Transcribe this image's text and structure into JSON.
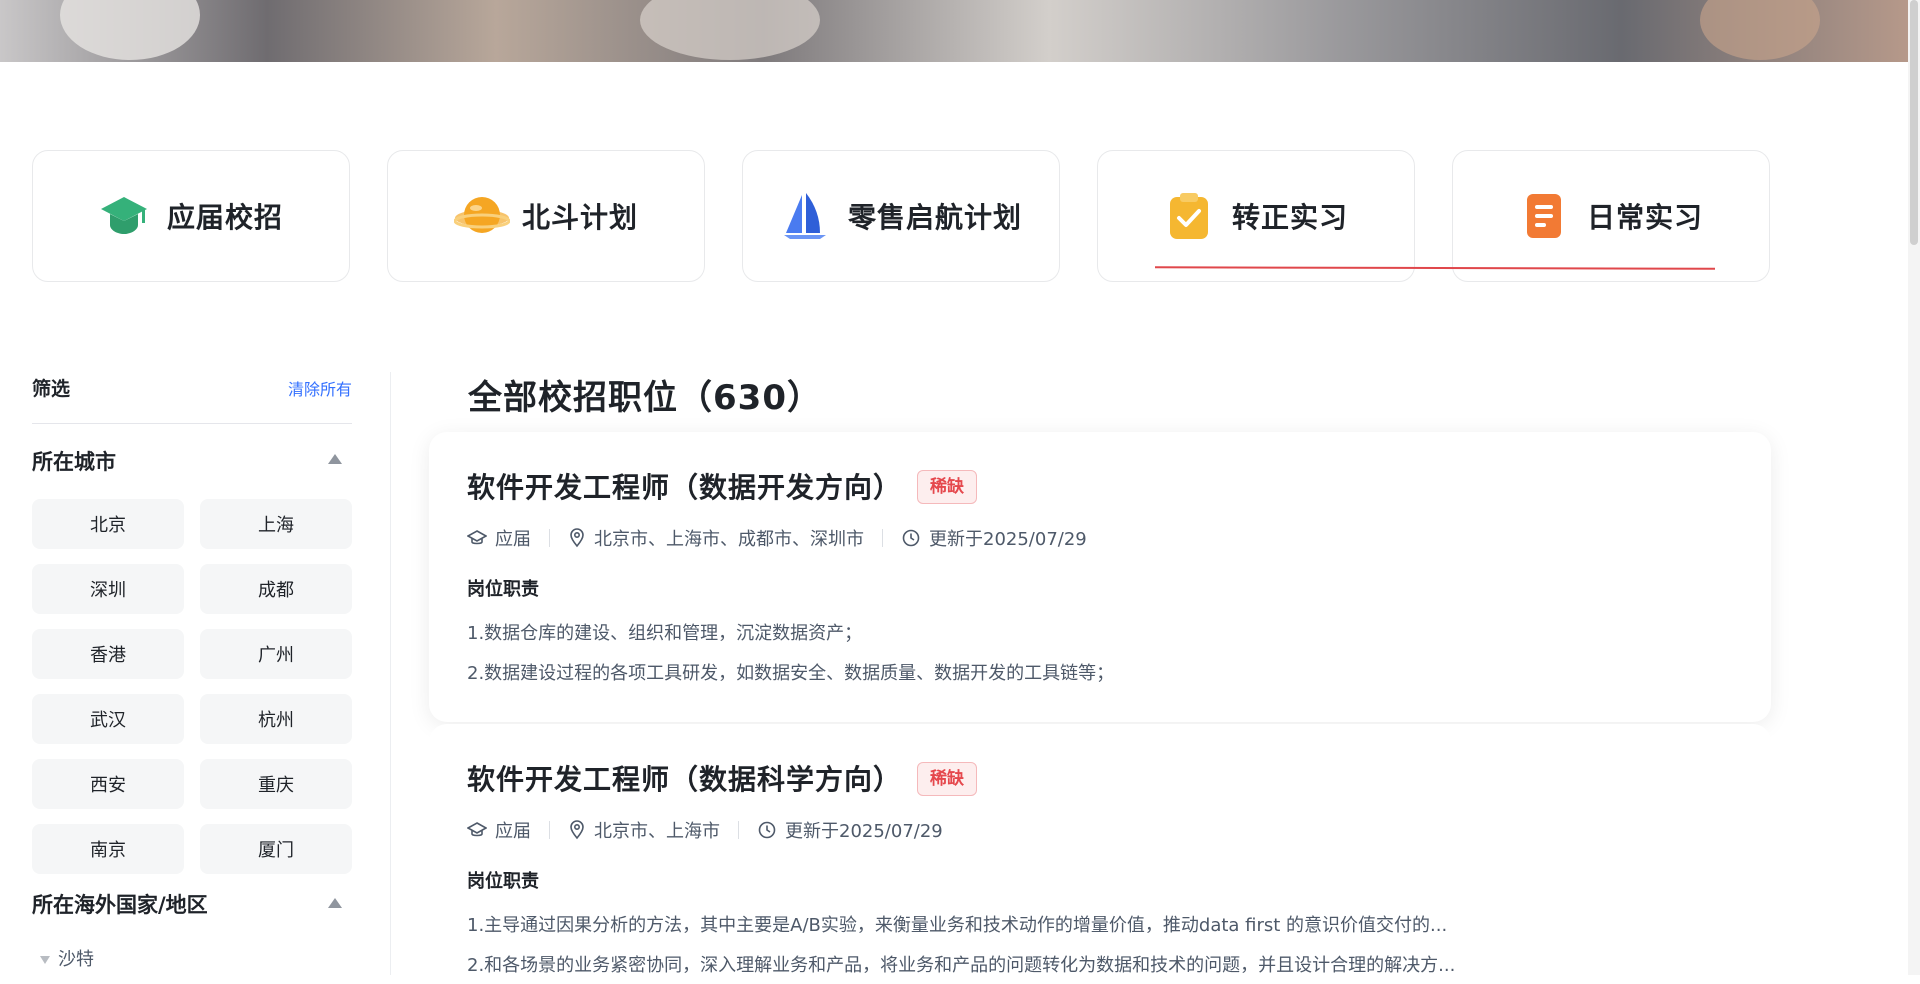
{
  "categories": [
    {
      "label": "应届校招",
      "icon": "graduation-cap-icon"
    },
    {
      "label": "北斗计划",
      "icon": "planet-icon"
    },
    {
      "label": "零售启航计划",
      "icon": "sailboat-icon"
    },
    {
      "label": "转正实习",
      "icon": "clipboard-check-icon"
    },
    {
      "label": "日常实习",
      "icon": "document-list-icon"
    }
  ],
  "sidebar": {
    "filter_title": "筛选",
    "clear_all": "清除所有",
    "city_section_title": "所在城市",
    "cities": [
      "北京",
      "上海",
      "深圳",
      "成都",
      "香港",
      "广州",
      "武汉",
      "杭州",
      "西安",
      "重庆",
      "南京",
      "厦门"
    ],
    "overseas_section_title": "所在海外国家/地区",
    "overseas": [
      "沙特"
    ]
  },
  "main": {
    "title": "全部校招职位（630）",
    "jobs": [
      {
        "title": "软件开发工程师（数据开发方向）",
        "tag": "稀缺",
        "type": "应届",
        "locations": "北京市、上海市、成都市、深圳市",
        "updated": "更新于2025/07/29",
        "duty_title": "岗位职责",
        "duties": [
          "1.数据仓库的建设、组织和管理，沉淀数据资产；",
          "2.数据建设过程的各项工具研发，如数据安全、数据质量、数据开发的工具链等；"
        ]
      },
      {
        "title": "软件开发工程师（数据科学方向）",
        "tag": "稀缺",
        "type": "应届",
        "locations": "北京市、上海市",
        "updated": "更新于2025/07/29",
        "duty_title": "岗位职责",
        "duties": [
          "1.主导通过因果分析的方法，其中主要是A/B实验，来衡量业务和技术动作的增量价值，推动data first 的意识价值交付的...",
          "2.和各场景的业务紧密协同，深入理解业务和产品，将业务和产品的问题转化为数据和技术的问题，并且设计合理的解决方..."
        ]
      }
    ]
  },
  "colors": {
    "accent_blue": "#3370ff",
    "tag_red": "#e5484d",
    "active_underline": "#e0474b"
  }
}
